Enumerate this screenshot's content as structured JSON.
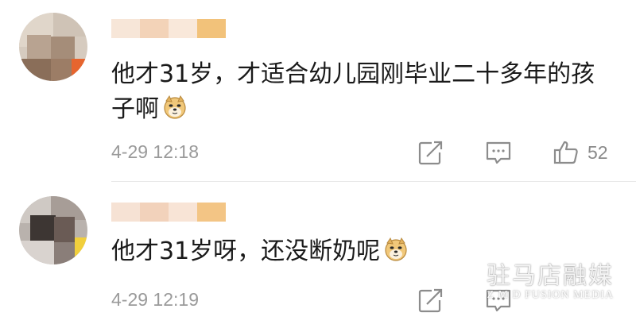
{
  "comments": [
    {
      "text": "他才31岁，才适合幼儿园刚毕业二十多年的孩子啊",
      "timestamp": "4-29 12:18",
      "likes": "52",
      "emoji": "doge-emoji"
    },
    {
      "text": "他才31岁呀，还没断奶呢",
      "timestamp": "4-29 12:19",
      "likes": "",
      "emoji": "doge-emoji"
    }
  ],
  "icons": {
    "share": "share-icon",
    "reply": "comment-icon",
    "like": "thumbs-up-icon"
  },
  "colors": {
    "text": "#1a1a1a",
    "meta": "#9a9a9a",
    "icon": "#8c8c8c",
    "background": "#ffffff"
  },
  "watermark": {
    "chinese": "驻马店融媒",
    "english": "Z M D FUSION MEDIA"
  }
}
